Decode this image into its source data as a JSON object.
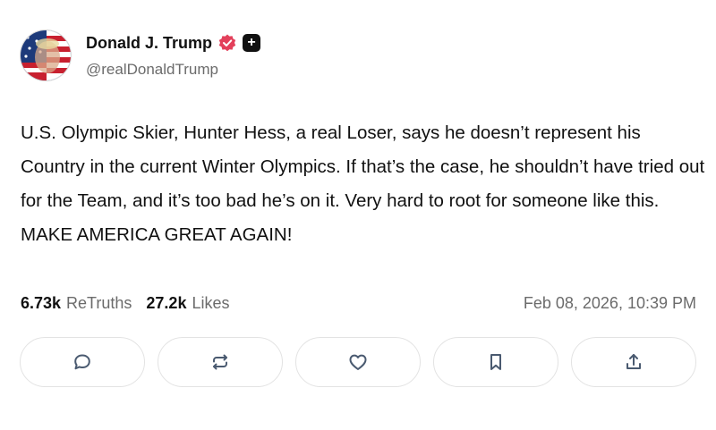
{
  "post": {
    "author": {
      "display_name": "Donald J. Trump",
      "handle": "@realDonaldTrump",
      "verified_icon": "verified-badge-icon",
      "plus_badge": "+"
    },
    "text": "U.S. Olympic Skier, Hunter Hess, a real Loser, says he doesn’t represent his Country in the current Winter Olympics. If that’s the case, he shouldn’t have tried out for the Team, and it’s too bad he’s on it. Very hard to root for someone like this. MAKE AMERICA GREAT AGAIN!",
    "stats": {
      "retruths_count": "6.73k",
      "retruths_label": "ReTruths",
      "likes_count": "27.2k",
      "likes_label": "Likes"
    },
    "timestamp": "Feb 08, 2026, 10:39 PM"
  },
  "actions": [
    {
      "icon": "reply-icon"
    },
    {
      "icon": "retruth-icon"
    },
    {
      "icon": "like-icon"
    },
    {
      "icon": "bookmark-icon"
    },
    {
      "icon": "share-icon"
    }
  ],
  "colors": {
    "text": "#111111",
    "muted": "#6b6b6b",
    "verified_badge": "#e3405b",
    "icon": "#4a5a70",
    "button_border": "#e3e3e3"
  }
}
